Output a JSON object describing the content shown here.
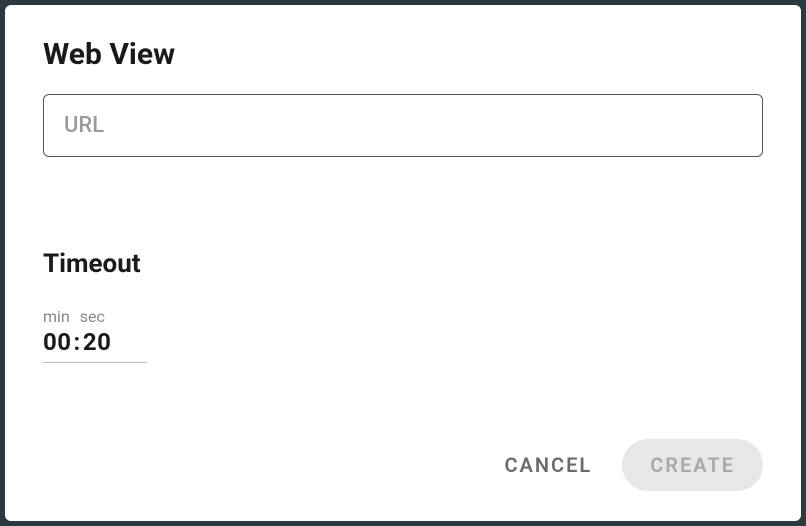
{
  "dialog": {
    "title": "Web View",
    "url_placeholder": "URL",
    "url_value": ""
  },
  "timeout": {
    "title": "Timeout",
    "labels": {
      "min": "min",
      "sec": "sec"
    },
    "minutes": "00",
    "seconds": "20",
    "separator": ":"
  },
  "actions": {
    "cancel_label": "CANCEL",
    "create_label": "CREATE"
  }
}
